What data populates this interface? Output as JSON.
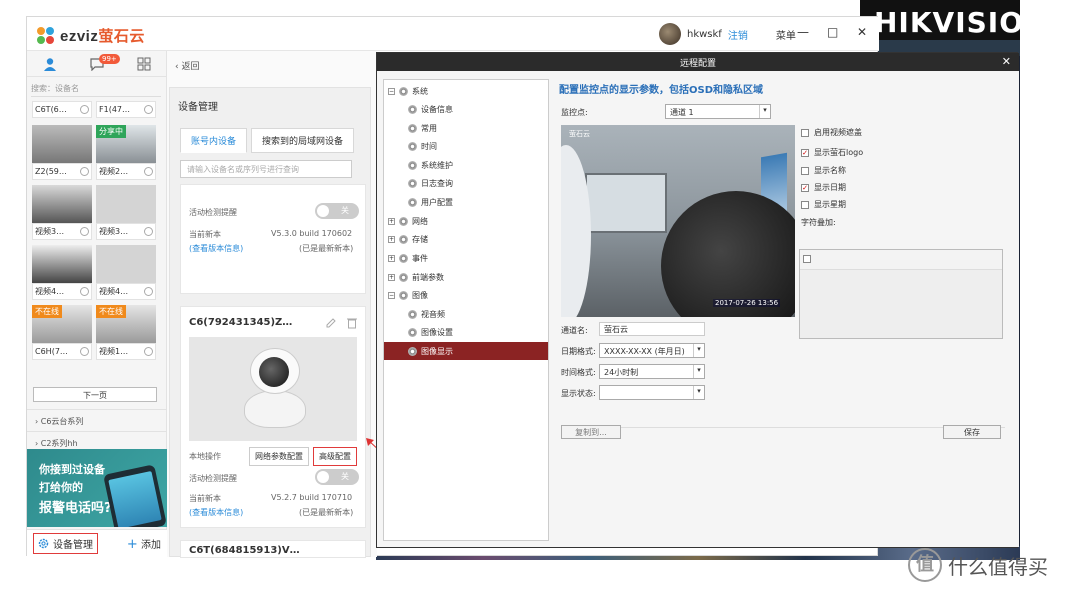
{
  "background": {
    "logo_text": "HIKVISIO"
  },
  "app": {
    "brand_ez": "ezviz",
    "brand_cn": "萤石云",
    "user": {
      "name": "hkwskf",
      "logout": "注销",
      "menu": "菜单"
    },
    "window": {
      "minimize": "—",
      "maximize": "□",
      "close": "✕"
    }
  },
  "sidebar": {
    "tabs": [
      "person-icon",
      "chat-icon",
      "grid-icon"
    ],
    "badge": "99+",
    "search_placeholder": "搜索：设备名",
    "cells": [
      {
        "label": "C6T(6…",
        "tag": ""
      },
      {
        "label": "F1(47…",
        "tag": ""
      },
      {
        "label": "Z2(59…",
        "tag": ""
      },
      {
        "label": "视频2…",
        "tag": "分享中"
      },
      {
        "label": "视频3…",
        "tag": ""
      },
      {
        "label": "视频3…",
        "tag": ""
      },
      {
        "label": "视频4…",
        "tag": ""
      },
      {
        "label": "视频4…",
        "tag": ""
      },
      {
        "label": "C6H(7…",
        "tag": "不在线"
      },
      {
        "label": "视频1…",
        "tag": "不在线"
      }
    ],
    "next_page": "下一页",
    "series": [
      "C6云台系列",
      "C2系列hh"
    ],
    "ad": {
      "line1": "你接到过设备",
      "line2": "打给你的",
      "line3": "报警电话吗?"
    },
    "device_mgmt": "设备管理",
    "add": "添加"
  },
  "middle": {
    "back": "返回",
    "title": "设备管理",
    "tabs": [
      "账号内设备",
      "搜索到的局域网设备"
    ],
    "filter_placeholder": "请输入设备名或序列号进行查询",
    "card1": {
      "motion": "活动检测提醒",
      "toggle": "关",
      "version_label": "当前新本",
      "version": "V5.3.0 build 170602",
      "view_info": "(查看版本信息)",
      "latest": "(已是最新新本)"
    },
    "card2": {
      "name": "C6(792431345)Z…",
      "local_ops": "本地操作",
      "net_config": "网络参数配置",
      "adv_config": "高级配置",
      "motion": "活动检测提醒",
      "toggle": "关",
      "version_label": "当前新本",
      "version": "V5.2.7 build 170710",
      "view_info": "(查看版本信息)",
      "latest": "(已是最新新本)"
    },
    "card3": {
      "name": "C6T(684815913)V…"
    }
  },
  "dialog": {
    "title": "远程配置",
    "tree": [
      {
        "label": "系统",
        "kind": "group",
        "sign": "−"
      },
      {
        "label": "设备信息",
        "kind": "leaf"
      },
      {
        "label": "常用",
        "kind": "leaf"
      },
      {
        "label": "时间",
        "kind": "leaf"
      },
      {
        "label": "系统维护",
        "kind": "leaf"
      },
      {
        "label": "日志查询",
        "kind": "leaf"
      },
      {
        "label": "用户配置",
        "kind": "leaf"
      },
      {
        "label": "网络",
        "kind": "group",
        "sign": "+"
      },
      {
        "label": "存储",
        "kind": "group",
        "sign": "+"
      },
      {
        "label": "事件",
        "kind": "group",
        "sign": "+"
      },
      {
        "label": "前端参数",
        "kind": "group",
        "sign": "+"
      },
      {
        "label": "图像",
        "kind": "group",
        "sign": "−"
      },
      {
        "label": "视音频",
        "kind": "leaf"
      },
      {
        "label": "图像设置",
        "kind": "leaf"
      },
      {
        "label": "图像显示",
        "kind": "leaf",
        "selected": true
      }
    ],
    "heading": "配置监控点的显示参数，包括OSD和隐私区域",
    "channel_label": "监控点:",
    "channel_value": "通道 1",
    "preview": {
      "osd_logo": "萤石云",
      "osd_date": "2017-07-26 13:56"
    },
    "checks": [
      {
        "label": "启用视频遮盖",
        "checked": false
      },
      {
        "label": "显示萤石logo",
        "checked": true
      },
      {
        "label": "显示名称",
        "checked": false
      },
      {
        "label": "显示日期",
        "checked": true
      },
      {
        "label": "显示星期",
        "checked": false
      }
    ],
    "overlay_label": "字符叠加:",
    "channel_name_label": "通道名:",
    "channel_name_value": "萤石云",
    "date_format_label": "日期格式:",
    "date_format_value": "XXXX-XX-XX (年月日)",
    "time_format_label": "时间格式:",
    "time_format_value": "24小时制",
    "display_state_label": "显示状态:",
    "display_state_value": "",
    "copy_btn": "复制到...",
    "save_btn": "保存"
  },
  "watermark": {
    "mark": "值",
    "text": "什么值得买"
  }
}
